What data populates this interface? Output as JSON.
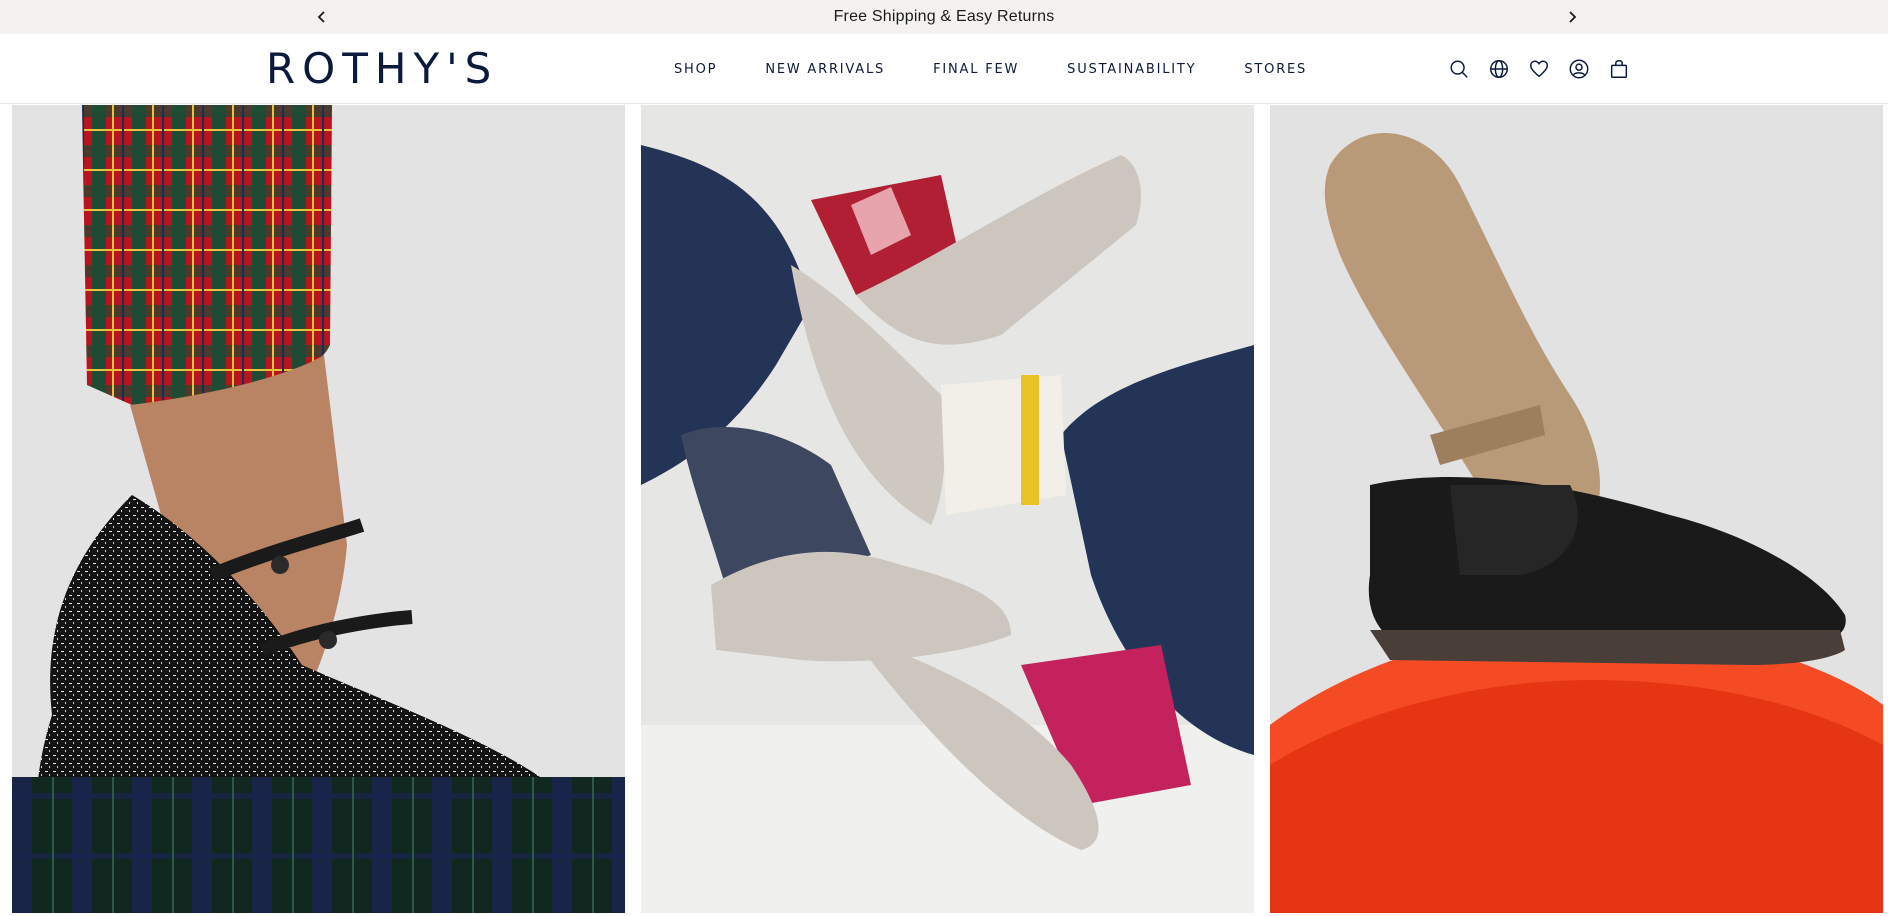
{
  "announcement": {
    "text": "Free Shipping & Easy Returns",
    "prev_icon": "chevron-left-icon",
    "next_icon": "chevron-right-icon"
  },
  "header": {
    "logo": "ROTHY'S",
    "nav": [
      "SHOP",
      "NEW ARRIVALS",
      "FINAL FEW",
      "SUSTAINABILITY",
      "STORES"
    ],
    "icons": [
      "search-icon",
      "globe-icon",
      "heart-icon",
      "account-icon",
      "bag-icon"
    ]
  },
  "colors": {
    "brand_navy": "#0b1a3a",
    "announcement_bg": "#f4f2ee"
  },
  "gallery": {
    "panels": [
      {
        "name": "mary-jane-shoe-photo"
      },
      {
        "name": "slip-on-shoes-photo"
      },
      {
        "name": "loafer-photo"
      }
    ]
  }
}
